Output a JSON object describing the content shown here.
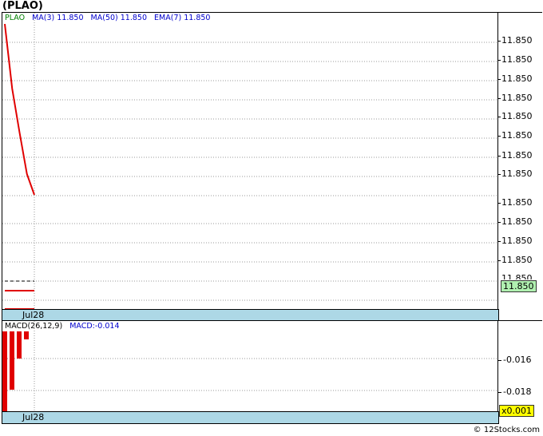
{
  "title": "(PLAO)",
  "price_legend": {
    "symbol": "PLAO",
    "ma3": "MA(3)  11.850",
    "ma50": "MA(50)  11.850",
    "ema7": "EMA(7)  11.850"
  },
  "price_ticks": [
    "11.850",
    "11.850",
    "11.850",
    "11.850",
    "11.850",
    "11.850",
    "11.850",
    "11.850",
    "11.850",
    "11.850",
    "11.850",
    "11.850"
  ],
  "price_badge": "11.850",
  "date_label": "Jul28",
  "macd_legend": {
    "name": "MACD(26,12,9)",
    "value": "MACD:-0.014"
  },
  "macd_ticks": [
    "-0.016",
    "-0.018"
  ],
  "macd_badge": "x0.001",
  "footer": "© 12Stocks.com",
  "colors": {
    "price_line": "#e00000",
    "macd_bars": "#e00000",
    "legend_symbol": "#008000",
    "legend_ma": "#0000cc",
    "datebar": "#add8e6",
    "price_badge_bg": "#b0f0b0",
    "macd_badge_bg": "#ffff00"
  },
  "chart_data": [
    {
      "type": "line",
      "series": [
        {
          "name": "PLAO",
          "values": [
            11.86,
            11.858,
            11.856,
            11.854,
            11.852
          ]
        }
      ],
      "ylabel": "",
      "ylim": [
        11.83,
        11.86
      ]
    },
    {
      "type": "bar",
      "series": [
        {
          "name": "MACD(26,12,9)",
          "values": [
            -0.018,
            -0.017,
            -0.016,
            -0.014
          ]
        }
      ],
      "ylim": [
        -0.019,
        -0.013
      ]
    }
  ]
}
